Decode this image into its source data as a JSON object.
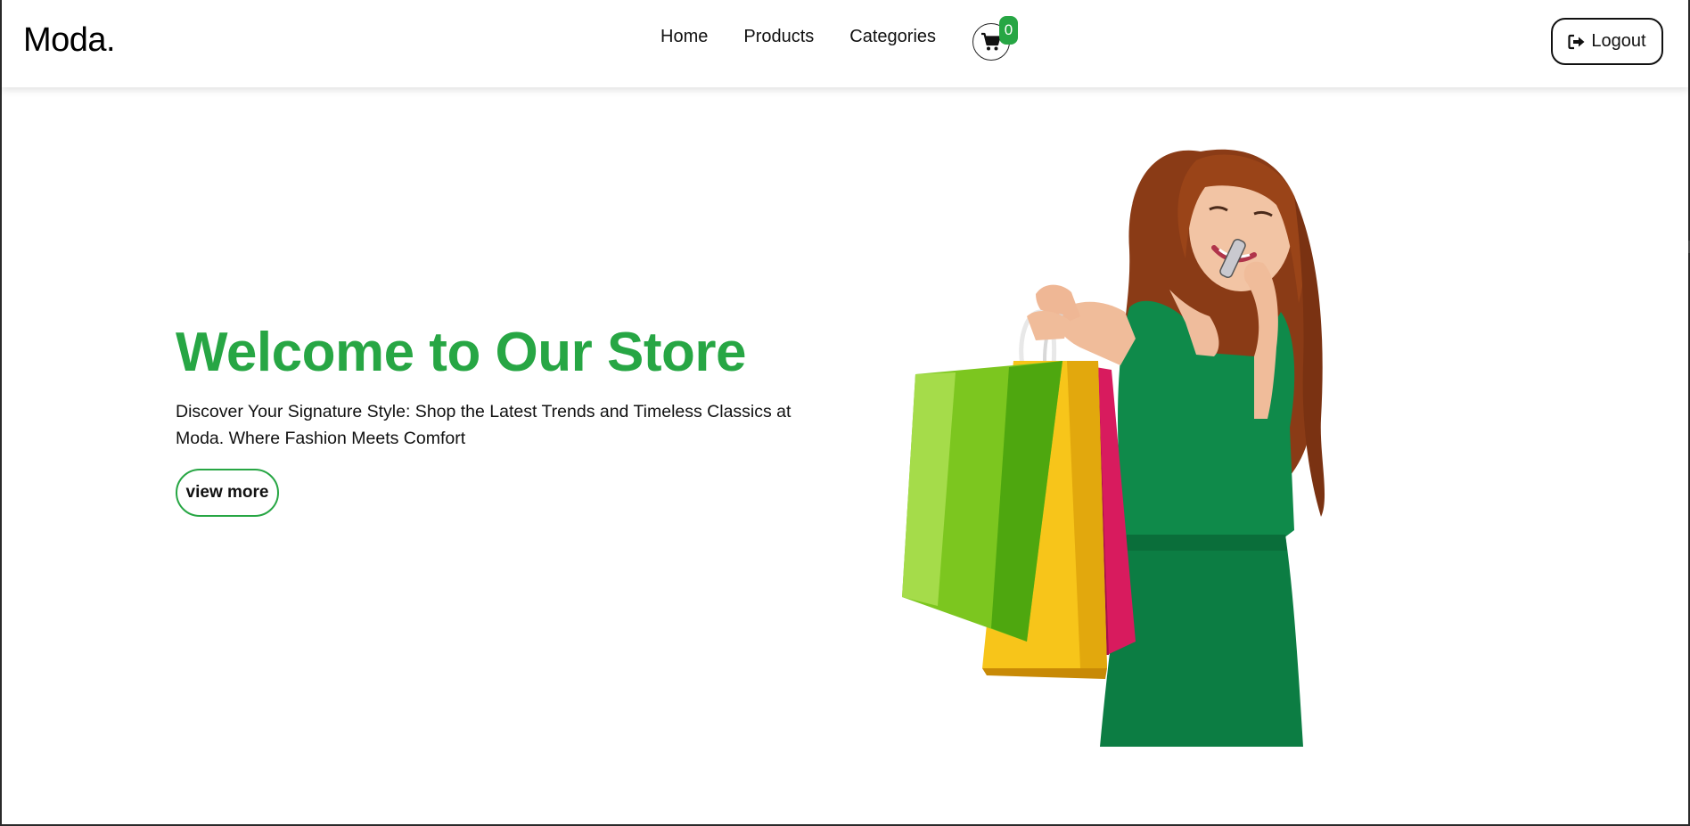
{
  "header": {
    "brand": "Moda.",
    "nav": [
      {
        "label": "Home"
      },
      {
        "label": "Products"
      },
      {
        "label": "Categories"
      }
    ],
    "cart": {
      "icon": "cart-icon",
      "count": "0"
    },
    "logout": {
      "icon": "logout-icon",
      "label": "Logout"
    }
  },
  "hero": {
    "title": "Welcome to Our Store",
    "text": "Discover Your Signature Style: Shop the Latest Trends and Timeless Classics at Moda. Where Fashion Meets Comfort",
    "button_label": "view more",
    "image": {
      "icon": "woman-with-shopping-bags-image"
    }
  },
  "colors": {
    "accent": "#27a644",
    "dress": "#0f8a4a",
    "bag_green": "#7cc61f",
    "bag_yellow": "#f7c51a",
    "bag_pink": "#d81b5e"
  }
}
